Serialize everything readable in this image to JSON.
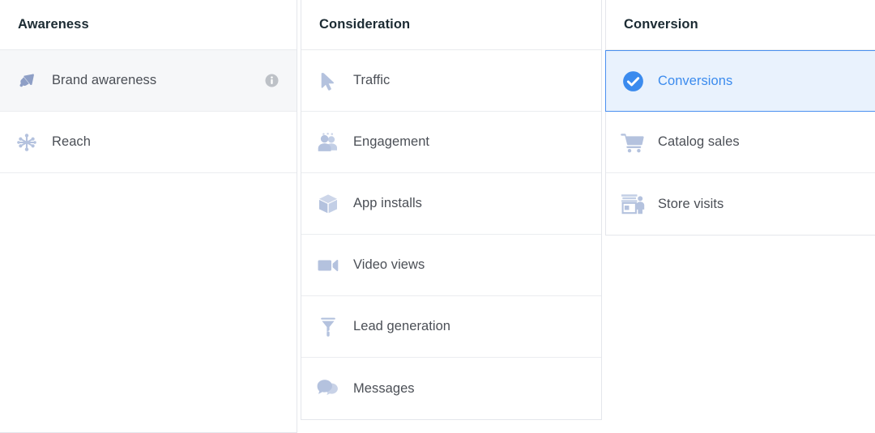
{
  "picker": {
    "name": "campaign-objective-picker",
    "accent_selected_bg": "#e9f2fd",
    "accent_selected_border": "#4a8ff0",
    "accent_selected_text": "#3b8bee",
    "icon_color": "#b4c2de",
    "hover_bg": "#f6f7f9",
    "text_color": "#4b4f56",
    "header_color": "#1c2b33",
    "columns": [
      {
        "key": "awareness",
        "header": "Awareness",
        "items": [
          {
            "label": "Brand awareness",
            "icon": "megaphone-icon",
            "state": "hovered",
            "has_info": true,
            "info_icon": "info-circle-icon"
          },
          {
            "label": "Reach",
            "icon": "reach-starburst-icon",
            "state": "default",
            "has_info": false
          }
        ]
      },
      {
        "key": "consideration",
        "header": "Consideration",
        "items": [
          {
            "label": "Traffic",
            "icon": "cursor-arrow-icon",
            "state": "default",
            "has_info": false
          },
          {
            "label": "Engagement",
            "icon": "people-group-icon",
            "state": "default",
            "has_info": false
          },
          {
            "label": "App installs",
            "icon": "cube-box-icon",
            "state": "default",
            "has_info": false
          },
          {
            "label": "Video views",
            "icon": "video-camera-icon",
            "state": "default",
            "has_info": false
          },
          {
            "label": "Lead generation",
            "icon": "funnel-icon",
            "state": "default",
            "has_info": false
          },
          {
            "label": "Messages",
            "icon": "speech-bubbles-icon",
            "state": "default",
            "has_info": false
          }
        ]
      },
      {
        "key": "conversion",
        "header": "Conversion",
        "items": [
          {
            "label": "Conversions",
            "icon": "check-circle-icon",
            "state": "selected",
            "has_info": false
          },
          {
            "label": "Catalog sales",
            "icon": "shopping-cart-icon",
            "state": "default",
            "has_info": false
          },
          {
            "label": "Store visits",
            "icon": "storefront-person-icon",
            "state": "default",
            "has_info": false
          }
        ]
      }
    ]
  }
}
